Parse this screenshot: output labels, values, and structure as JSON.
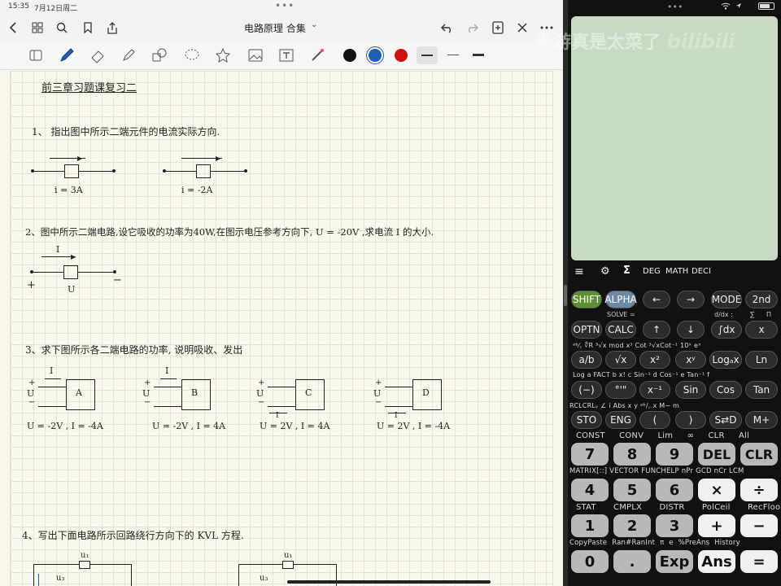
{
  "status": {
    "time": "15:35",
    "date": "7月12日周二"
  },
  "app": {
    "title": "电路原理 合集"
  },
  "colors": {
    "black": "#111111",
    "blue": "#1e5fb4",
    "red": "#cc1111"
  },
  "note": {
    "heading": "前三章习题课复习二",
    "q1": "1、 指出图中所示二端元件的电流实际方向.",
    "q1a": "i = 3A",
    "q1b": "i = -2A",
    "q2": "2、图中所示二端电路,设它吸收的功率为40W,在图示电压参考方向下, U = -20V ,求电流 I 的大小.",
    "q2_I": "I",
    "q2_U": "U",
    "q2_plus": "+",
    "q2_minus": "−",
    "q3": "3、求下图所示各二端电路的功率, 说明吸收、发出",
    "q3_circuits": [
      {
        "name": "A",
        "cond": "U = -2V , I = -4A"
      },
      {
        "name": "B",
        "cond": "U = -2V , I = 4A"
      },
      {
        "name": "C",
        "cond": "U = 2V , I = 4A"
      },
      {
        "name": "D",
        "cond": "U = 2V , I = -4A"
      }
    ],
    "q3_U": "U",
    "q3_I": "I",
    "q4": "4、写出下面电路所示回路绕行方向下的 KVL 方程.",
    "q4_u1": "u₁",
    "q4_u3": "u₃"
  },
  "calculator": {
    "watermark": "老游真是太菜了",
    "menu": {
      "deg": "DEG",
      "math": "MATH",
      "deci": "DECI"
    },
    "row1": [
      "SHIFT",
      "ALPHA",
      "←",
      "→",
      "MODE",
      "2nd"
    ],
    "row1_sub": [
      "SOLVE =",
      "d/dx :",
      "∑",
      "Π"
    ],
    "row2": [
      "OPTN",
      "CALC",
      "↑",
      "↓",
      "∫dx",
      "x"
    ],
    "row2_sub": "ᵃᵇ⁄꜀ ∜R ³√x mod x³ Cot ³√xCot⁻¹ 10ˣ eˣ",
    "row3": [
      "a/b",
      "√x",
      "x²",
      "xʸ",
      "Logₐx",
      "Ln"
    ],
    "row3_sub": "Log a FACT b x! c Sin⁻¹ d Cos⁻¹ e Tan⁻¹ f",
    "row4": [
      "(−)",
      "°'\"",
      "x⁻¹",
      "Sin",
      "Cos",
      "Tan"
    ],
    "row4_sub": "RCLCRLᵥ ∠ i Abs x y ᵃᵇ/꜀ x M− m",
    "row5": [
      "STO",
      "ENG",
      "(",
      ")",
      "S⇄D",
      "M+"
    ],
    "row5_sub": "CONST CONV Lim ∞ CLR All",
    "row6": [
      "7",
      "8",
      "9",
      "DEL",
      "CLR"
    ],
    "row6_sub": "MATRIX[::] VECTOR FUNCHELP nPr GCD nCr LCM",
    "row7": [
      "4",
      "5",
      "6",
      "×",
      "÷"
    ],
    "row7_sub": "STAT CMPLX DISTR PolCeil RecFloor",
    "row8": [
      "1",
      "2",
      "3",
      "+",
      "−"
    ],
    "row8_sub": "CopyPaste Ran#RanInt π e %PreAns History",
    "row9": [
      "0",
      ".",
      "Exp",
      "Ans",
      "="
    ]
  }
}
